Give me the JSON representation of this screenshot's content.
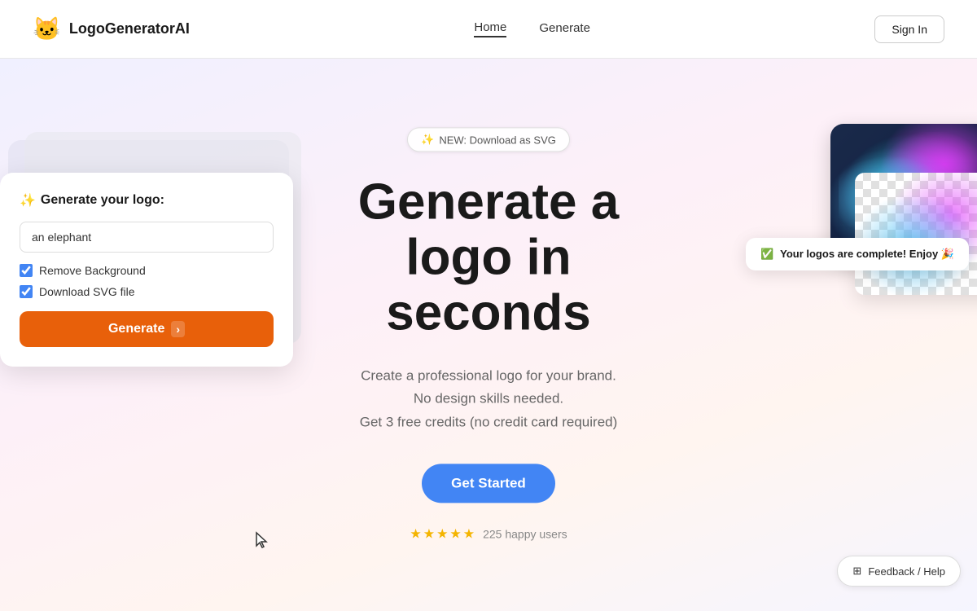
{
  "brand": {
    "logo_icon": "🐱",
    "name": "LogoGeneratorAI"
  },
  "nav": {
    "links": [
      {
        "id": "home",
        "label": "Home",
        "active": true
      },
      {
        "id": "generate",
        "label": "Generate",
        "active": false
      }
    ],
    "sign_in_label": "Sign In"
  },
  "hero": {
    "badge_icon": "✨",
    "badge_text": "NEW: Download as SVG",
    "title_line1": "Generate a",
    "title_line2": "logo in",
    "title_line3": "seconds",
    "subtitle_line1": "Create a professional logo for your brand.",
    "subtitle_line2": "No design skills needed.",
    "subtitle_line3": "Get 3 free credits (no credit card required)",
    "cta_label": "Get Started",
    "stars": "★★★★★",
    "happy_users": "225 happy users"
  },
  "left_card": {
    "title_icon": "✨",
    "title": "Generate your logo:",
    "input_placeholder": "an elephant",
    "input_value": "an elephant",
    "checkbox_remove_bg": "Remove Background",
    "checkbox_download_svg": "Download SVG file",
    "generate_btn": "Generate",
    "remove_bg_checked": true,
    "download_svg_checked": true
  },
  "toast": {
    "icon": "✅",
    "text": "Your logos are complete! Enjoy 🎉"
  },
  "feedback": {
    "icon": "⊞",
    "label": "Feedback / Help"
  }
}
